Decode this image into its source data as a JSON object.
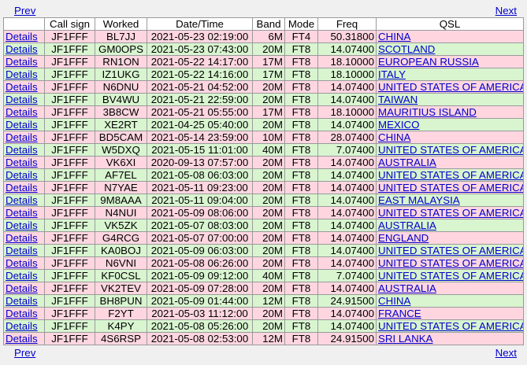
{
  "nav": {
    "prev": "Prev",
    "next": "Next"
  },
  "headers": [
    "",
    "Call sign",
    "Worked",
    "Date/Time",
    "Band",
    "Mode",
    "Freq",
    "QSL"
  ],
  "rows": [
    {
      "details": "Details",
      "call": "JF1FFF",
      "worked": "BL7JJ",
      "datetime": "2021-05-23 02:19:00",
      "band": "6M",
      "mode": "FT4",
      "freq": "50.31800",
      "qsl": "CHINA",
      "color": "pink"
    },
    {
      "details": "Details",
      "call": "JF1FFF",
      "worked": "GM0OPS",
      "datetime": "2021-05-23 07:43:00",
      "band": "20M",
      "mode": "FT8",
      "freq": "14.07400",
      "qsl": "SCOTLAND",
      "color": "green"
    },
    {
      "details": "Details",
      "call": "JF1FFF",
      "worked": "RN1ON",
      "datetime": "2021-05-22 14:17:00",
      "band": "17M",
      "mode": "FT8",
      "freq": "18.10000",
      "qsl": "EUROPEAN RUSSIA",
      "color": "pink"
    },
    {
      "details": "Details",
      "call": "JF1FFF",
      "worked": "IZ1UKG",
      "datetime": "2021-05-22 14:16:00",
      "band": "17M",
      "mode": "FT8",
      "freq": "18.10000",
      "qsl": "ITALY",
      "color": "green"
    },
    {
      "details": "Details",
      "call": "JF1FFF",
      "worked": "N6DNU",
      "datetime": "2021-05-21 04:52:00",
      "band": "20M",
      "mode": "FT8",
      "freq": "14.07400",
      "qsl": "UNITED STATES OF AMERICA",
      "color": "pink"
    },
    {
      "details": "Details",
      "call": "JF1FFF",
      "worked": "BV4WU",
      "datetime": "2021-05-21 22:59:00",
      "band": "20M",
      "mode": "FT8",
      "freq": "14.07400",
      "qsl": "TAIWAN",
      "color": "green"
    },
    {
      "details": "Details",
      "call": "JF1FFF",
      "worked": "3B8CW",
      "datetime": "2021-05-21 05:55:00",
      "band": "17M",
      "mode": "FT8",
      "freq": "18.10000",
      "qsl": "MAURITIUS ISLAND",
      "color": "pink"
    },
    {
      "details": "Details",
      "call": "JF1FFF",
      "worked": "XE2RT",
      "datetime": "2021-04-25 05:40:00",
      "band": "20M",
      "mode": "FT8",
      "freq": "14.07400",
      "qsl": "MEXICO",
      "color": "green"
    },
    {
      "details": "Details",
      "call": "JF1FFF",
      "worked": "BD5CAM",
      "datetime": "2021-05-14 23:59:00",
      "band": "10M",
      "mode": "FT8",
      "freq": "28.07400",
      "qsl": "CHINA",
      "color": "pink"
    },
    {
      "details": "Details",
      "call": "JF1FFF",
      "worked": "W5DXQ",
      "datetime": "2021-05-15 11:01:00",
      "band": "40M",
      "mode": "FT8",
      "freq": "7.07400",
      "qsl": "UNITED STATES OF AMERICA",
      "color": "green"
    },
    {
      "details": "Details",
      "call": "JF1FFF",
      "worked": "VK6XI",
      "datetime": "2020-09-13 07:57:00",
      "band": "20M",
      "mode": "FT8",
      "freq": "14.07400",
      "qsl": "AUSTRALIA",
      "color": "pink"
    },
    {
      "details": "Details",
      "call": "JF1FFF",
      "worked": "AF7EL",
      "datetime": "2021-05-08 06:03:00",
      "band": "20M",
      "mode": "FT8",
      "freq": "14.07400",
      "qsl": "UNITED STATES OF AMERICA",
      "color": "green"
    },
    {
      "details": "Details",
      "call": "JF1FFF",
      "worked": "N7YAE",
      "datetime": "2021-05-11 09:23:00",
      "band": "20M",
      "mode": "FT8",
      "freq": "14.07400",
      "qsl": "UNITED STATES OF AMERICA",
      "color": "pink"
    },
    {
      "details": "Details",
      "call": "JF1FFF",
      "worked": "9M8AAA",
      "datetime": "2021-05-11 09:04:00",
      "band": "20M",
      "mode": "FT8",
      "freq": "14.07400",
      "qsl": "EAST MALAYSIA",
      "color": "green"
    },
    {
      "details": "Details",
      "call": "JF1FFF",
      "worked": "N4NUI",
      "datetime": "2021-05-09 08:06:00",
      "band": "20M",
      "mode": "FT8",
      "freq": "14.07400",
      "qsl": "UNITED STATES OF AMERICA",
      "color": "pink"
    },
    {
      "details": "Details",
      "call": "JF1FFF",
      "worked": "VK5ZK",
      "datetime": "2021-05-07 08:03:00",
      "band": "20M",
      "mode": "FT8",
      "freq": "14.07400",
      "qsl": "AUSTRALIA",
      "color": "green"
    },
    {
      "details": "Details",
      "call": "JF1FFF",
      "worked": "G4RCG",
      "datetime": "2021-05-07 07:00:00",
      "band": "20M",
      "mode": "FT8",
      "freq": "14.07400",
      "qsl": "ENGLAND",
      "color": "pink"
    },
    {
      "details": "Details",
      "call": "JF1FFF",
      "worked": "KA0BOJ",
      "datetime": "2021-05-09 06:03:00",
      "band": "20M",
      "mode": "FT8",
      "freq": "14.07400",
      "qsl": "UNITED STATES OF AMERICA",
      "color": "green"
    },
    {
      "details": "Details",
      "call": "JF1FFF",
      "worked": "N6VNI",
      "datetime": "2021-05-08 06:26:00",
      "band": "20M",
      "mode": "FT8",
      "freq": "14.07400",
      "qsl": "UNITED STATES OF AMERICA",
      "color": "pink"
    },
    {
      "details": "Details",
      "call": "JF1FFF",
      "worked": "KF0CSL",
      "datetime": "2021-05-09 09:12:00",
      "band": "40M",
      "mode": "FT8",
      "freq": "7.07400",
      "qsl": "UNITED STATES OF AMERICA",
      "color": "green"
    },
    {
      "details": "Details",
      "call": "JF1FFF",
      "worked": "VK2TEV",
      "datetime": "2021-05-09 07:28:00",
      "band": "20M",
      "mode": "FT8",
      "freq": "14.07400",
      "qsl": "AUSTRALIA",
      "color": "pink"
    },
    {
      "details": "Details",
      "call": "JF1FFF",
      "worked": "BH8PUN",
      "datetime": "2021-05-09 01:44:00",
      "band": "12M",
      "mode": "FT8",
      "freq": "24.91500",
      "qsl": "CHINA",
      "color": "green"
    },
    {
      "details": "Details",
      "call": "JF1FFF",
      "worked": "F2YT",
      "datetime": "2021-05-03 11:12:00",
      "band": "20M",
      "mode": "FT8",
      "freq": "14.07400",
      "qsl": "FRANCE",
      "color": "pink"
    },
    {
      "details": "Details",
      "call": "JF1FFF",
      "worked": "K4PY",
      "datetime": "2021-05-08 05:26:00",
      "band": "20M",
      "mode": "FT8",
      "freq": "14.07400",
      "qsl": "UNITED STATES OF AMERICA",
      "color": "green"
    },
    {
      "details": "Details",
      "call": "JF1FFF",
      "worked": "4S6RSP",
      "datetime": "2021-05-08 02:53:00",
      "band": "12M",
      "mode": "FT8",
      "freq": "24.91500",
      "qsl": "SRI LANKA",
      "color": "pink"
    }
  ]
}
